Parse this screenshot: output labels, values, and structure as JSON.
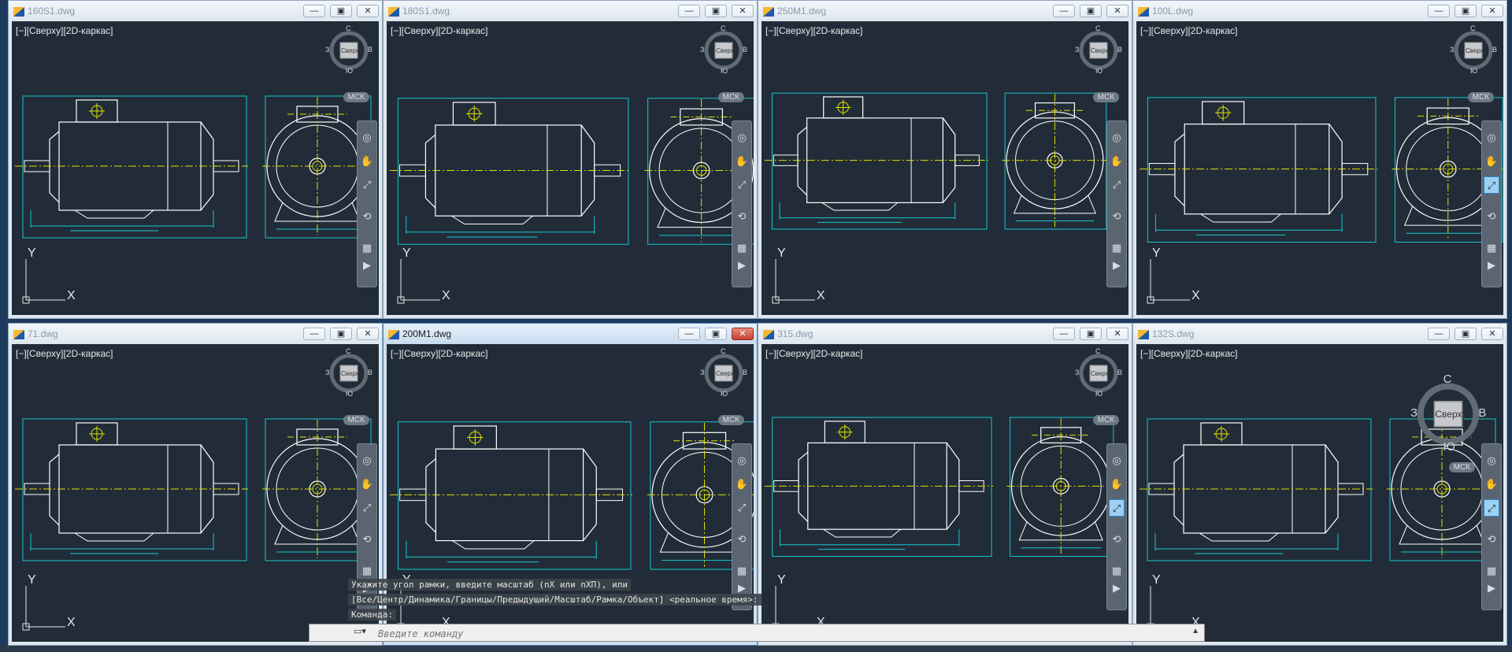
{
  "viewport_label": "[−][Сверху][2D-каркас]",
  "viewcube": {
    "north": "С",
    "south": "Ю",
    "west": "З",
    "east": "В",
    "face": "Сверху"
  },
  "ucs_label": "МСК",
  "axis_labels": {
    "x": "X",
    "y": "Y"
  },
  "windows": [
    {
      "title": "160S1.dwg",
      "active": false
    },
    {
      "title": "180S1.dwg",
      "active": false
    },
    {
      "title": "250M1.dwg",
      "active": false
    },
    {
      "title": "100L.dwg",
      "active": false
    },
    {
      "title": "71.dwg",
      "active": false
    },
    {
      "title": "200M1.dwg",
      "active": true
    },
    {
      "title": "315.dwg",
      "active": false
    },
    {
      "title": "132S.dwg",
      "active": false
    }
  ],
  "window_buttons": {
    "minimize": "—",
    "maximize": "▣",
    "close": "✕"
  },
  "command_line": {
    "history": [
      "Укажите угол рамки, введите масштаб (nX или nXП), или",
      "[Все/Центр/Динамика/Границы/Предыдущий/Масштаб/Рамка/Объект] <реальное время>:",
      "Команда:"
    ],
    "placeholder": "Введите команду"
  },
  "colors": {
    "background": "#212c38",
    "outline": "#ffffff",
    "dimension": "#17c7cf",
    "centerline": "#e1e100"
  }
}
